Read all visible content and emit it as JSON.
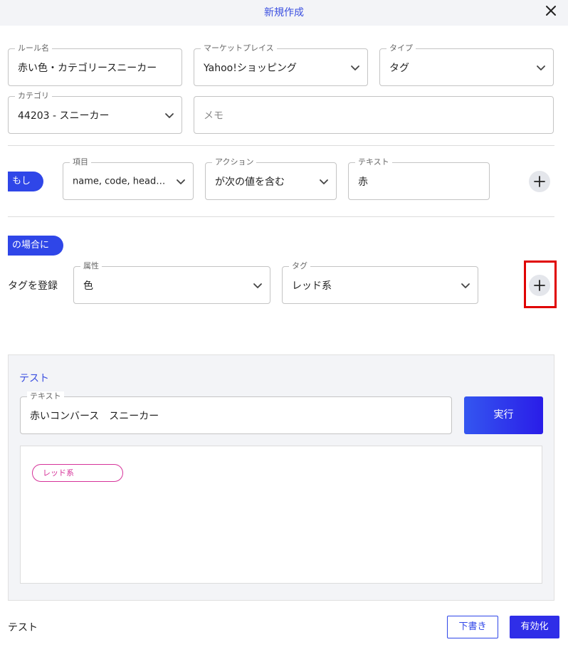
{
  "dialog": {
    "title": "新規作成"
  },
  "rule": {
    "name_label": "ルール名",
    "name_value": "赤い色・カテゴリースニーカー",
    "marketplace_label": "マーケットプレイス",
    "marketplace_value": "Yahoo!ショッピング",
    "type_label": "タイプ",
    "type_value": "タグ",
    "category_label": "カテゴリ",
    "category_value": "44203 - スニーカー",
    "memo_placeholder": "メモ"
  },
  "condition": {
    "if_label": "もし",
    "item_label": "項目",
    "item_value": "name, code, head…",
    "action_label": "アクション",
    "action_value": "が次の値を含む",
    "text_label": "テキスト",
    "text_value": "赤"
  },
  "result": {
    "then_label": "の場合に",
    "register_tag_label": "タグを登録",
    "attribute_label": "属性",
    "attribute_value": "色",
    "tag_label": "タグ",
    "tag_value": "レッド系"
  },
  "test": {
    "title": "テスト",
    "text_label": "テキスト",
    "text_value": "赤いコンバース　スニーカー",
    "run_label": "実行",
    "result_tags": [
      "レッド系"
    ]
  },
  "footer": {
    "left_label": "テスト",
    "draft_label": "下書き",
    "enable_label": "有効化"
  },
  "icons": {
    "close": "close-icon",
    "chevron": "chevron-down-icon",
    "plus": "plus-icon"
  },
  "colors": {
    "accent": "#2f46e8",
    "tag_chip": "#d6339a",
    "highlight": "#e00000",
    "header_bg": "#f3f4f7"
  }
}
